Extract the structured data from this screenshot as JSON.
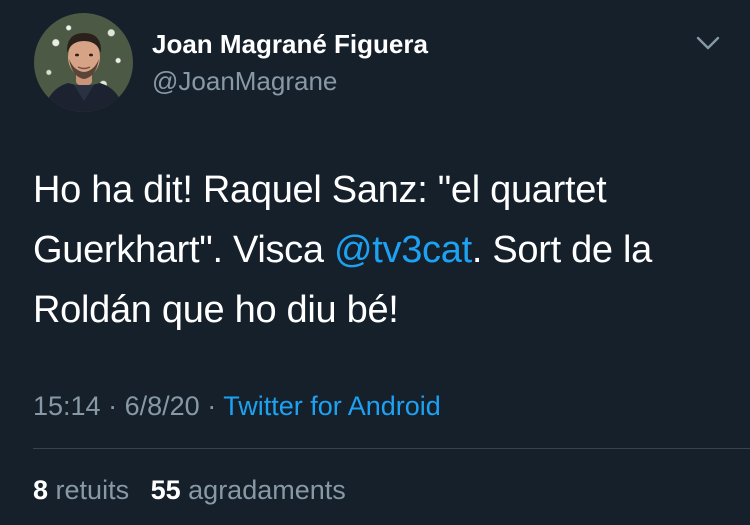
{
  "author": {
    "name": "Joan Magrané Figuera",
    "handle": "@JoanMagrane"
  },
  "tweet": {
    "text_part1": "Ho ha dit! Raquel Sanz: \"el quartet Guerkhart\". Visca ",
    "mention": "@tv3cat",
    "text_part2": ". Sort de la Roldán que ho diu bé!"
  },
  "meta": {
    "time": "15:14",
    "separator": "·",
    "date": "6/8/20",
    "source": "Twitter for Android"
  },
  "stats": {
    "retweets_count": "8",
    "retweets_label": "retuits",
    "likes_count": "55",
    "likes_label": "agradaments"
  },
  "colors": {
    "background": "#15202b",
    "text": "#ffffff",
    "secondary": "#8899a6",
    "accent": "#1da1f2",
    "divider": "#38444d"
  },
  "icons": {
    "menu": "chevron-down-icon",
    "avatar": "profile-photo"
  }
}
